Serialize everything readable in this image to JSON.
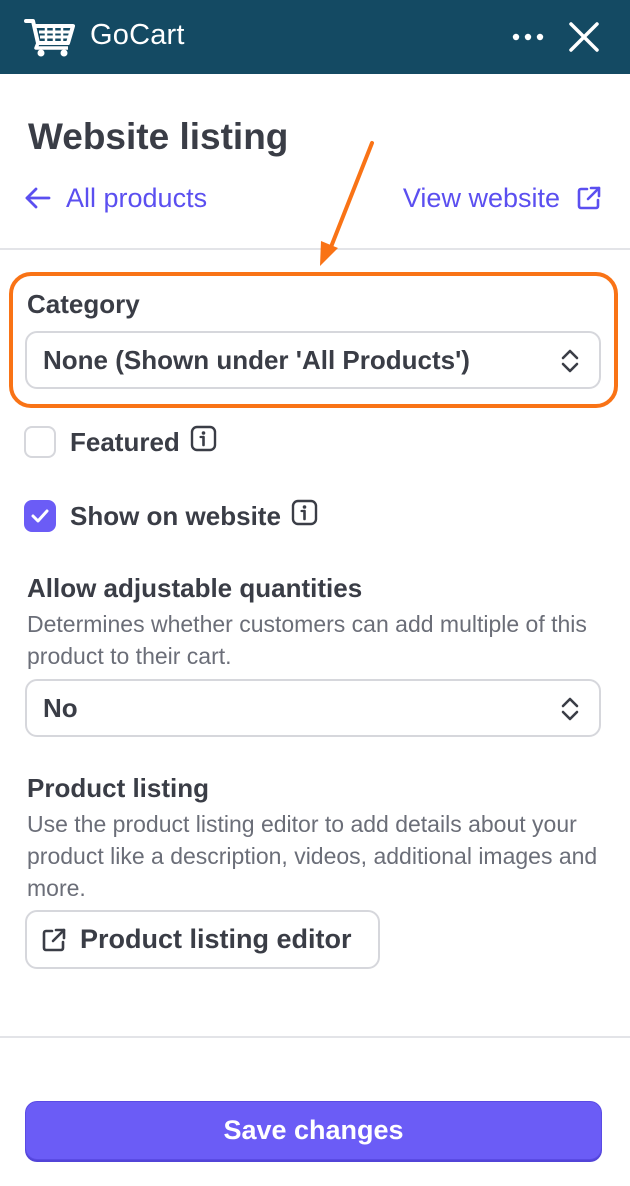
{
  "header": {
    "app_name": "GoCart",
    "cart_icon": "shopping-cart-icon",
    "more_icon": "more-dots-icon",
    "close_icon": "close-icon",
    "background_color": "#144a63"
  },
  "page": {
    "title": "Website listing",
    "back_link": "All products",
    "view_link": "View website"
  },
  "category": {
    "label": "Category",
    "selected": "None (Shown under 'All Products')",
    "highlight_color": "#f97316"
  },
  "featured": {
    "label": "Featured",
    "checked": false
  },
  "show_on_website": {
    "label": "Show on website",
    "checked": true
  },
  "adjustable_quantities": {
    "label": "Allow adjustable quantities",
    "help": "Determines whether customers can add multiple of this product to their cart.",
    "selected": "No"
  },
  "product_listing": {
    "label": "Product listing",
    "help": "Use the product listing editor to add details about your product like a description, videos, additional images and more.",
    "button_label": "Product listing editor"
  },
  "footer": {
    "save_label": "Save changes"
  },
  "colors": {
    "accent": "#6b5cf6",
    "link": "#5b4ff0",
    "text": "#3a3d46"
  }
}
